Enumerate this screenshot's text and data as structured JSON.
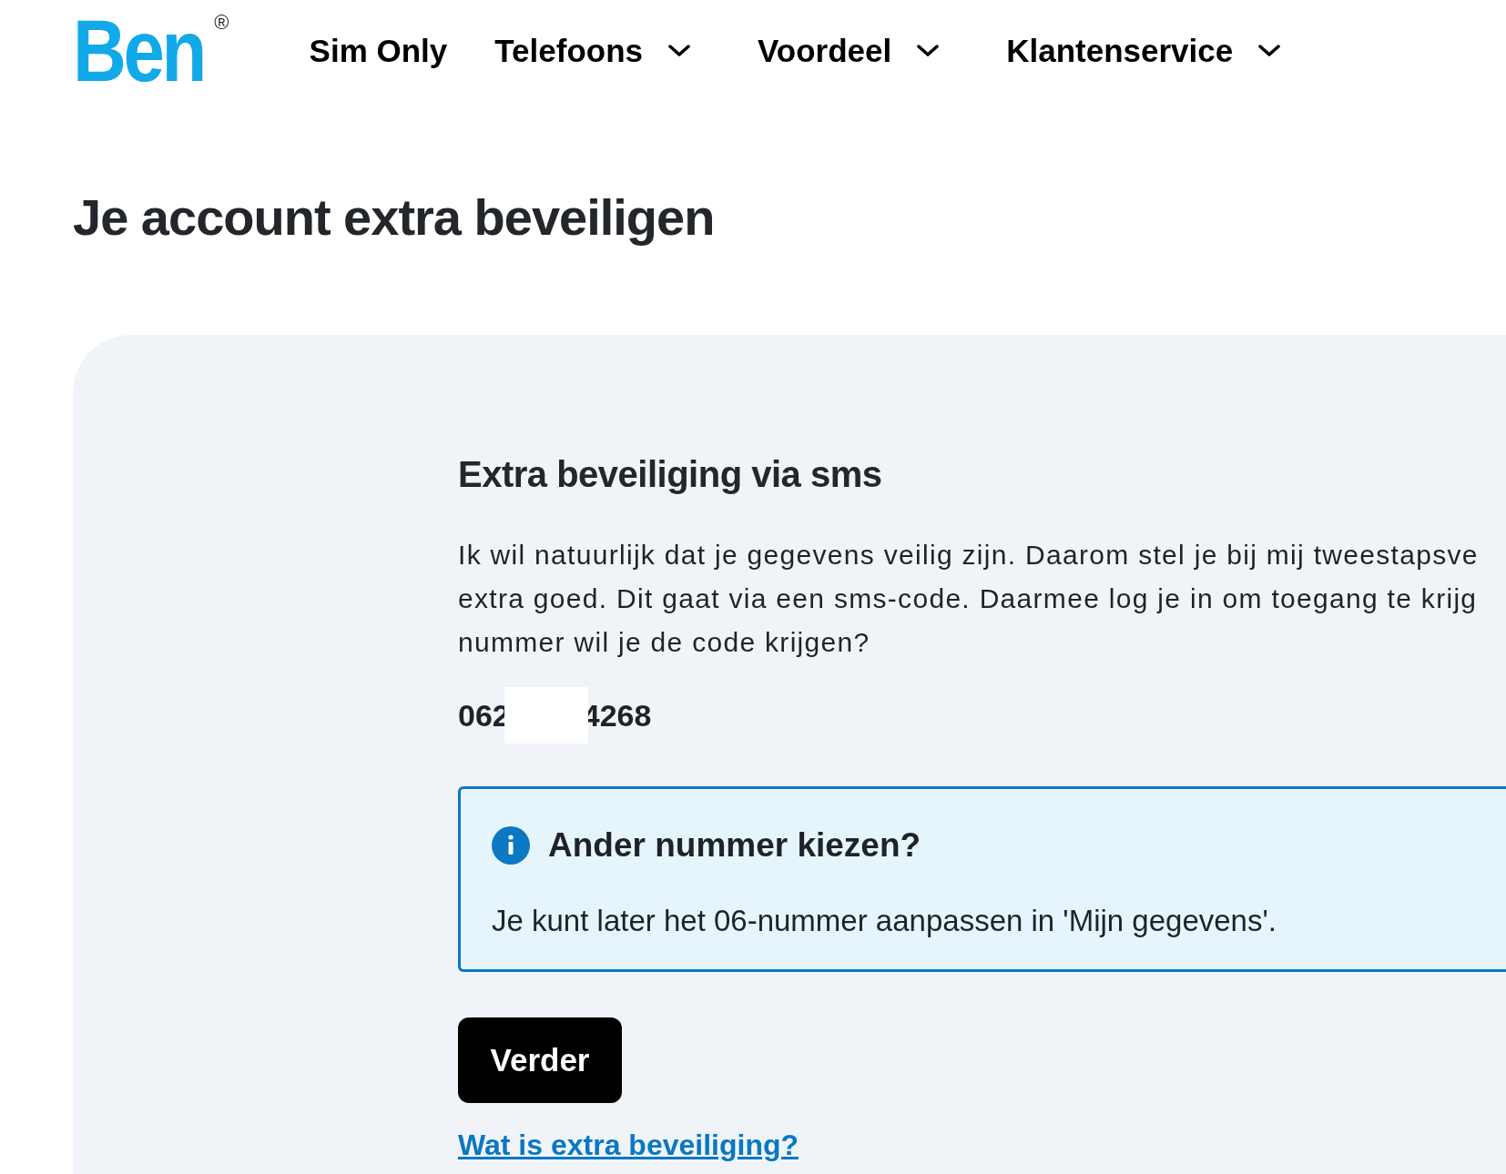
{
  "header": {
    "logo": "Ben",
    "logo_mark": "®",
    "nav": [
      {
        "label": "Sim Only",
        "has_menu": false
      },
      {
        "label": "Telefoons",
        "has_menu": true
      },
      {
        "label": "Voordeel",
        "has_menu": true
      },
      {
        "label": "Klantenservice",
        "has_menu": true
      }
    ]
  },
  "page_title": "Je account extra beveiligen",
  "card": {
    "title": "Extra beveiliging via sms",
    "intro_lines": [
      "Ik wil natuurlijk dat je gegevens veilig zijn. Daarom stel je bij mij tweestapsve",
      "extra goed. Dit gaat via een sms-code. Daarmee log je in om toegang te krijg",
      "nummer wil je de code krijgen?"
    ],
    "phone_start": "062",
    "phone_end": "4268",
    "info": {
      "title": "Ander nummer kiezen?",
      "text": "Je kunt later het 06-nummer aanpassen in 'Mijn gegevens'."
    },
    "button": "Verder",
    "link": "Wat is extra beveiliging?"
  }
}
